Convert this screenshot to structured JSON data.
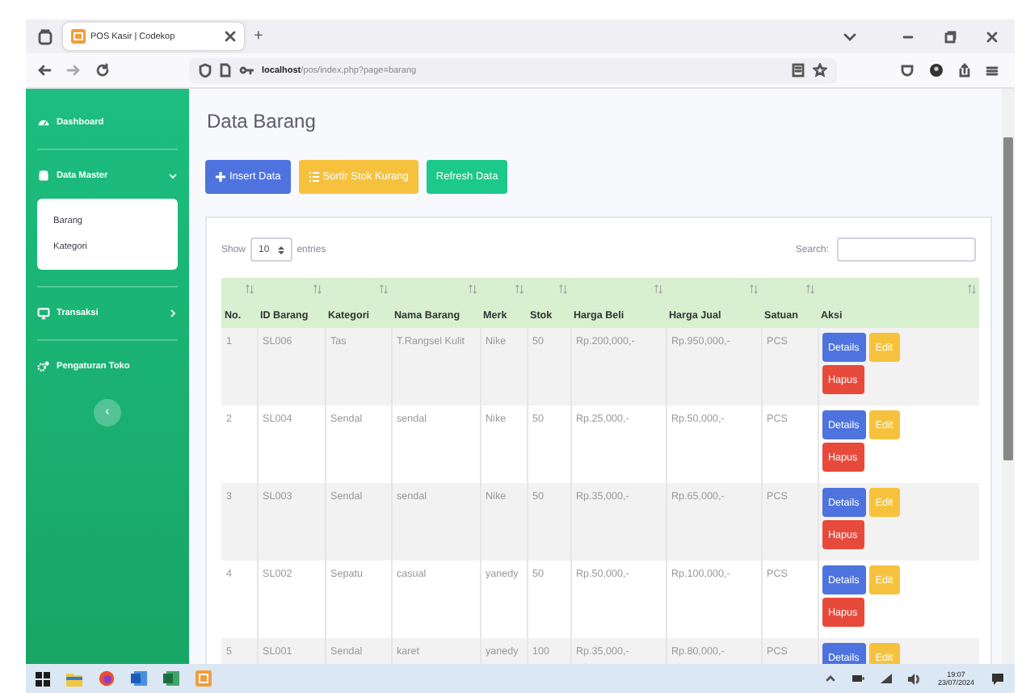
{
  "browser": {
    "tab_title": "POS Kasir | Codekop",
    "new_tab": "+",
    "url": "**localhost**/pos/index.php?page=barang"
  },
  "sidebar": {
    "items": [
      {
        "label": "Dashboard",
        "kind": "gauge"
      },
      {
        "label": "Data Master",
        "kind": "database",
        "expanded": true,
        "children": [
          {
            "label": "Barang"
          },
          {
            "label": "Kategori"
          }
        ]
      },
      {
        "label": "Transaksi",
        "kind": "desktop",
        "expanded": false
      },
      {
        "label": "Pengaturan Toko",
        "kind": "cogs"
      }
    ],
    "toggle": "‹"
  },
  "page": {
    "title": "Data Barang",
    "buttons": [
      {
        "label": "Insert Data",
        "kind": "primary"
      },
      {
        "label": "Sortir Stok Kurang",
        "kind": "warning"
      },
      {
        "label": "Refresh Data",
        "kind": "success"
      }
    ],
    "show_label": "Show",
    "length": "10",
    "entries_label": "entries",
    "search_label": "Search:",
    "table": {
      "columns": [
        "No.",
        "ID Barang",
        "Kategori",
        "Nama Barang",
        "Merk",
        "Stok",
        "Harga Beli",
        "Harga Jual",
        "Satuan",
        "Aksi"
      ],
      "rows": [
        {
          "cells": [
            "1",
            "SL006",
            "Tas",
            "T.Rangsel Kulit",
            "Nike",
            "50",
            "Rp.200,000,-",
            "Rp.950,000,-",
            "PCS"
          ],
          "actions": [
            {
              "label": "Details",
              "kind": "info"
            },
            {
              "label": "Edit",
              "kind": "edit"
            },
            {
              "label": "Hapus",
              "kind": "delete"
            }
          ]
        },
        {
          "cells": [
            "2",
            "SL004",
            "Sendal",
            "sendal",
            "Nike",
            "50",
            "Rp.25,000,-",
            "Rp.50,000,-",
            "PCS"
          ],
          "actions": [
            {
              "label": "Details",
              "kind": "info"
            },
            {
              "label": "Edit",
              "kind": "edit"
            },
            {
              "label": "Hapus",
              "kind": "delete"
            }
          ]
        },
        {
          "cells": [
            "3",
            "SL003",
            "Sendal",
            "sendal",
            "Nike",
            "50",
            "Rp.35,000,-",
            "Rp.65,000,-",
            "PCS"
          ],
          "actions": [
            {
              "label": "Details",
              "kind": "info"
            },
            {
              "label": "Edit",
              "kind": "edit"
            },
            {
              "label": "Hapus",
              "kind": "delete"
            }
          ]
        },
        {
          "cells": [
            "4",
            "SL002",
            "Sepatu",
            "casual",
            "yanedy",
            "50",
            "Rp.50,000,-",
            "Rp.100,000,-",
            "PCS"
          ],
          "actions": [
            {
              "label": "Details",
              "kind": "info"
            },
            {
              "label": "Edit",
              "kind": "edit"
            },
            {
              "label": "Hapus",
              "kind": "delete"
            }
          ]
        },
        {
          "cells": [
            "5",
            "SL001",
            "Sendal",
            "karet",
            "yanedy",
            "100",
            "Rp.35,000,-",
            "Rp.80,000,-",
            "PCS"
          ],
          "actions": [
            {
              "label": "Details",
              "kind": "info"
            },
            {
              "label": "Edit",
              "kind": "edit"
            }
          ]
        }
      ]
    }
  },
  "taskbar": {
    "time": "19:07",
    "date": "23/07/2024"
  }
}
